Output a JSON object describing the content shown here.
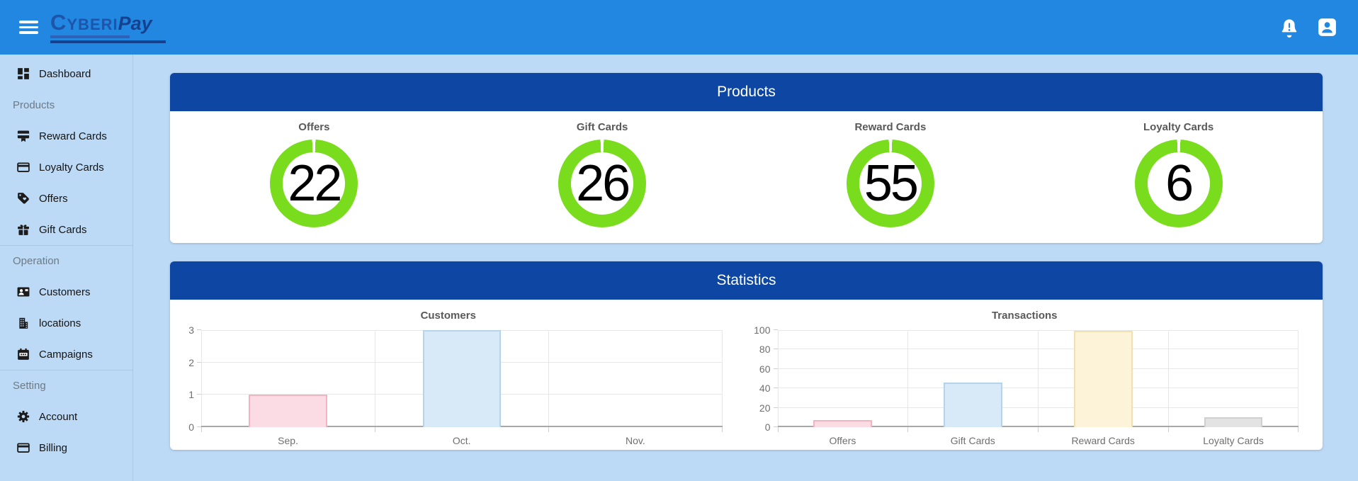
{
  "colors": {
    "topbar_bg": "#2187e0",
    "page_bg": "#bcdaf6",
    "panel_header_bg": "#0e46a3",
    "panel_bg": "#ffffff",
    "gauge_ring": "#79dd1d",
    "gauge_value_text": "#000000",
    "heading_text": "#595959",
    "sidebar_text": "#141414",
    "section_text": "#6e7a85",
    "divider": "#a9c8e6",
    "grid_line": "#e7e7e7",
    "axis_line": "#a8a8a8",
    "tick_text": "#6f6f6f",
    "logo_main": "#1d55aa",
    "logo_accent": "#16418f"
  },
  "topbar": {
    "brand_main": "Cyberi",
    "brand_accent": "Pay",
    "icons": [
      "menu-icon",
      "bell-icon",
      "account-icon"
    ]
  },
  "sidebar": {
    "items": [
      {
        "kind": "link",
        "label": "Dashboard",
        "icon": "dashboard-icon"
      },
      {
        "kind": "section",
        "label": "Products"
      },
      {
        "kind": "link",
        "label": "Reward Cards",
        "icon": "reward-cards-icon"
      },
      {
        "kind": "link",
        "label": "Loyalty Cards",
        "icon": "loyalty-cards-icon"
      },
      {
        "kind": "link",
        "label": "Offers",
        "icon": "offers-tag-icon"
      },
      {
        "kind": "link",
        "label": "Gift Cards",
        "icon": "gift-icon"
      },
      {
        "kind": "section",
        "label": "Operation"
      },
      {
        "kind": "link",
        "label": "Customers",
        "icon": "customers-icon"
      },
      {
        "kind": "link",
        "label": "locations",
        "icon": "building-icon"
      },
      {
        "kind": "link",
        "label": "Campaigns",
        "icon": "calendar-icon"
      },
      {
        "kind": "section",
        "label": "Setting"
      },
      {
        "kind": "link",
        "label": "Account",
        "icon": "gear-icon"
      },
      {
        "kind": "link",
        "label": "Billing",
        "icon": "credit-card-icon"
      }
    ]
  },
  "products_panel": {
    "title": "Products",
    "gauges": [
      {
        "label": "Offers",
        "value": "22"
      },
      {
        "label": "Gift Cards",
        "value": "26"
      },
      {
        "label": "Reward Cards",
        "value": "55"
      },
      {
        "label": "Loyalty Cards",
        "value": "6"
      }
    ]
  },
  "statistics_panel": {
    "title": "Statistics"
  },
  "chart_data": [
    {
      "type": "bar",
      "title": "Customers",
      "categories": [
        "Sep.",
        "Oct.",
        "Nov."
      ],
      "values": [
        1,
        3,
        0
      ],
      "ylim": [
        0,
        3
      ],
      "yticks": [
        0,
        1,
        2,
        3
      ],
      "grid": true,
      "legend": "none",
      "bars": [
        {
          "fill": "#fbdce4",
          "border": "#f2b4c3"
        },
        {
          "fill": "#d8e9f8",
          "border": "#b5d3eb"
        },
        {
          "fill": "#fdf3d8",
          "border": "#f0e0b2"
        }
      ]
    },
    {
      "type": "bar",
      "title": "Transactions",
      "categories": [
        "Offers",
        "Gift Cards",
        "Reward Cards",
        "Loyalty Cards"
      ],
      "values": [
        7,
        46,
        99,
        10
      ],
      "ylim": [
        0,
        100
      ],
      "yticks": [
        0,
        20,
        40,
        60,
        80,
        100
      ],
      "grid": true,
      "legend": "none",
      "bars": [
        {
          "fill": "#fbdce4",
          "border": "#f2b4c3"
        },
        {
          "fill": "#d8e9f8",
          "border": "#b5d3eb"
        },
        {
          "fill": "#fdf3d8",
          "border": "#f0e0b2"
        },
        {
          "fill": "#e3e3e3",
          "border": "#cfcfcf"
        }
      ]
    }
  ]
}
